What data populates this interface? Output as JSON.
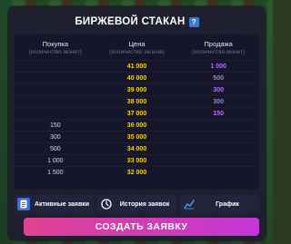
{
  "window": {
    "title": "БИРЖЕВОЙ СТАКАН",
    "help_glyph": "?"
  },
  "columns": {
    "buy": {
      "label": "Покупка",
      "sublabel": "(количество монет)"
    },
    "price": {
      "label": "Цена",
      "sublabel": "(количество эконов)"
    },
    "sell": {
      "label": "Продажа",
      "sublabel": "(количество монет)"
    }
  },
  "rows": [
    {
      "buy": "",
      "price": "41 000",
      "sell": "1 000"
    },
    {
      "buy": "",
      "price": "40 000",
      "sell": "500"
    },
    {
      "buy": "",
      "price": "39 000",
      "sell": "300"
    },
    {
      "buy": "",
      "price": "38 000",
      "sell": "300"
    },
    {
      "buy": "",
      "price": "37 000",
      "sell": "150"
    },
    {
      "buy": "150",
      "price": "36 000",
      "sell": ""
    },
    {
      "buy": "300",
      "price": "35 000",
      "sell": ""
    },
    {
      "buy": "500",
      "price": "34 000",
      "sell": ""
    },
    {
      "buy": "1 000",
      "price": "33 000",
      "sell": ""
    },
    {
      "buy": "1 500",
      "price": "32 000",
      "sell": ""
    }
  ],
  "actions": {
    "active_orders": {
      "label": "Активные заявки",
      "icon": "document-icon"
    },
    "order_history": {
      "label": "История заявок",
      "icon": "clock-icon"
    },
    "chart": {
      "label": "График",
      "icon": "chart-line-icon"
    }
  },
  "create_button": {
    "label": "СОЗДАТЬ ЗАЯВКУ"
  },
  "colors": {
    "price": "#f3d21b",
    "sell": "#b76cff",
    "create_gradient_start": "#e0428f",
    "create_gradient_end": "#c536d8"
  }
}
